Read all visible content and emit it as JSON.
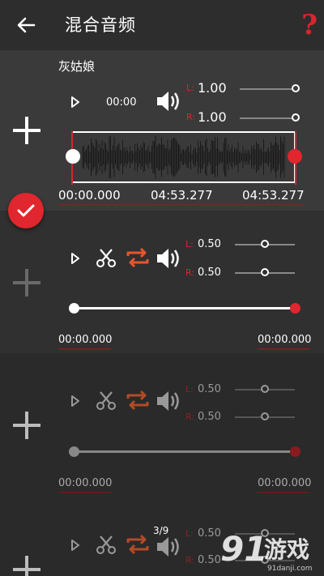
{
  "header": {
    "title": "混合音频",
    "help_label": "?"
  },
  "tracks": [
    {
      "name": "灰姑娘",
      "position_time": "00:00",
      "left_label": "L:",
      "right_label": "R:",
      "left_volume": "1.00",
      "right_volume": "1.00",
      "left_volume_level": 1.0,
      "right_volume_level": 1.0,
      "start_time": "00:00.000",
      "mid_time": "04:53.277",
      "end_time": "04:53.277",
      "selected": true
    },
    {
      "left_label": "L:",
      "right_label": "R:",
      "left_volume": "0.50",
      "right_volume": "0.50",
      "left_volume_level": 0.5,
      "right_volume_level": 0.5,
      "start_time": "00:00.000",
      "end_time": "00:00.000"
    },
    {
      "left_label": "L:",
      "right_label": "R:",
      "left_volume": "0.50",
      "right_volume": "0.50",
      "left_volume_level": 0.5,
      "right_volume_level": 0.5,
      "start_time": "00:00.000",
      "end_time": "00:00.000"
    },
    {
      "left_label": "L:",
      "right_label": "R:",
      "left_volume": "0.50",
      "right_volume": "0.50",
      "left_volume_level": 0.5,
      "right_volume_level": 0.5,
      "page_counter": "3/9"
    }
  ],
  "watermark": {
    "site": "91danji.com",
    "brand": "游戏"
  },
  "icons": {
    "back": "back-arrow-icon",
    "play": "play-icon",
    "speaker": "speaker-icon",
    "cut": "scissors-icon",
    "loop": "loop-icon",
    "add": "plus-icon",
    "confirm": "checkmark-icon"
  },
  "colors": {
    "accent": "#d8262e",
    "loop": "#e8552b",
    "background": "#2e2e2e"
  }
}
